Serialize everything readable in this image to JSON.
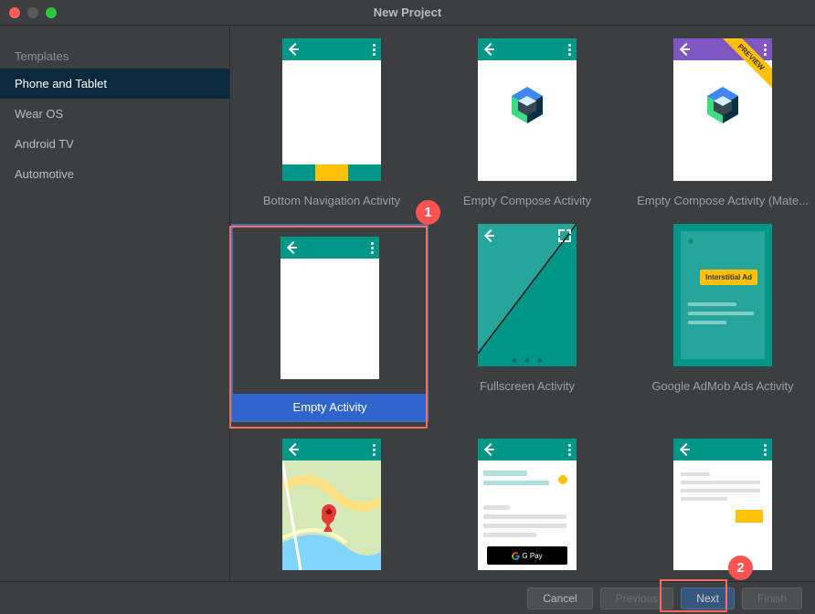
{
  "window": {
    "title": "New Project"
  },
  "sidebar": {
    "heading": "Templates",
    "items": [
      {
        "label": "Phone and Tablet",
        "selected": true
      },
      {
        "label": "Wear OS",
        "selected": false
      },
      {
        "label": "Android TV",
        "selected": false
      },
      {
        "label": "Automotive",
        "selected": false
      }
    ]
  },
  "templates": [
    {
      "id": "bottom-nav",
      "label": "Bottom Navigation Activity"
    },
    {
      "id": "empty-compose",
      "label": "Empty Compose Activity"
    },
    {
      "id": "empty-compose-mat",
      "label": "Empty Compose Activity (Mate...",
      "preview_badge": "PREVIEW"
    },
    {
      "id": "empty-activity",
      "label": "Empty Activity",
      "selected": true
    },
    {
      "id": "fullscreen",
      "label": "Fullscreen Activity"
    },
    {
      "id": "admob",
      "label": "Google AdMob Ads Activity",
      "chip": "Interstitial Ad"
    },
    {
      "id": "maps",
      "label": ""
    },
    {
      "id": "gpay",
      "label": "",
      "gpay_label": "G Pay"
    },
    {
      "id": "basic-views",
      "label": ""
    }
  ],
  "footer": {
    "cancel": "Cancel",
    "previous": "Previous",
    "next": "Next",
    "finish": "Finish"
  },
  "annotations": {
    "marker1": "1",
    "marker2": "2"
  }
}
